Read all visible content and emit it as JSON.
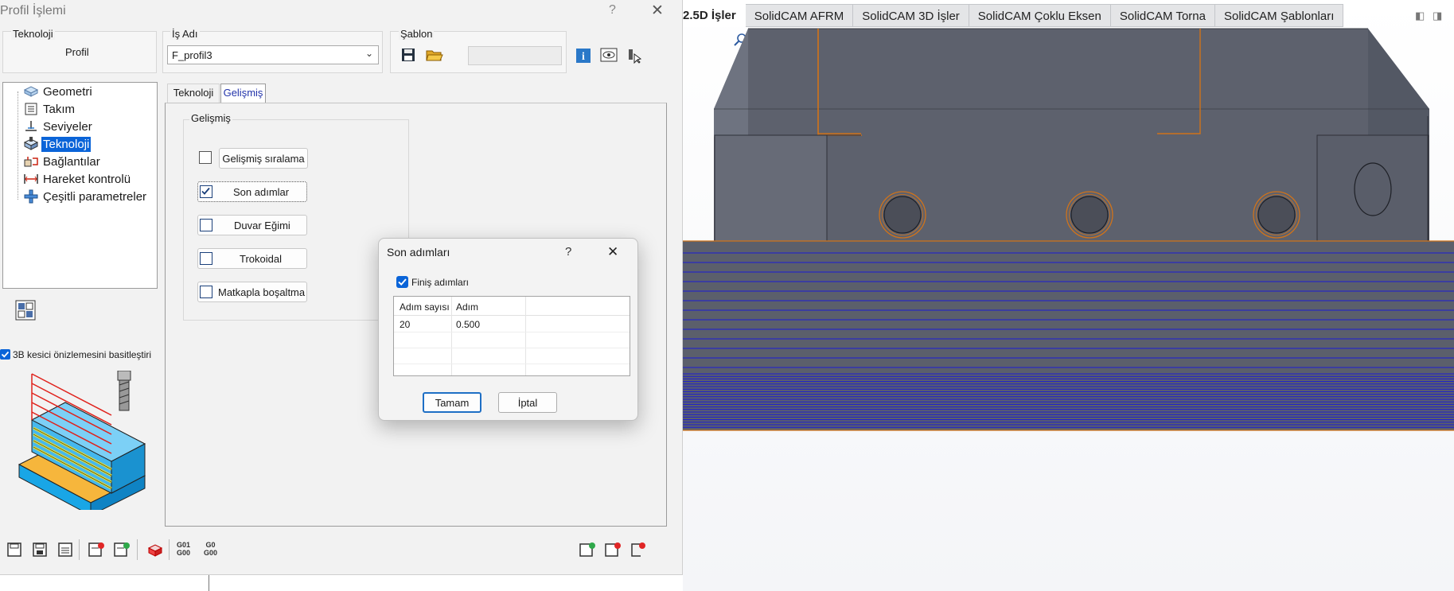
{
  "window": {
    "title": "Profil İşlemi",
    "help": "?",
    "close": "✕"
  },
  "header": {
    "teknoloji_label": "Teknoloji",
    "teknoloji_value": "Profil",
    "is_adi_label": "İş Adı",
    "is_adi_value": "F_profil3",
    "sablon_label": "Şablon"
  },
  "tree": {
    "items": [
      {
        "label": "Geometri",
        "icon": "geometry-icon"
      },
      {
        "label": "Takım",
        "icon": "tool-icon"
      },
      {
        "label": "Seviyeler",
        "icon": "levels-icon"
      },
      {
        "label": "Teknoloji",
        "icon": "technology-icon",
        "selected": true
      },
      {
        "label": "Bağlantılar",
        "icon": "links-icon"
      },
      {
        "label": "Hareket kontrolü",
        "icon": "motion-control-icon"
      },
      {
        "label": "Çeşitli parametreler",
        "icon": "misc-params-icon"
      }
    ]
  },
  "preview": {
    "checkbox_label": "3B kesici önizlemesini basitleştiri",
    "checked": true
  },
  "tabs": {
    "tab1": "Teknoloji",
    "tab2": "Gelişmiş",
    "active": "Gelişmiş"
  },
  "gelismis": {
    "group_label": "Gelişmiş",
    "options": [
      {
        "label": "Gelişmiş sıralama",
        "checked": false
      },
      {
        "label": "Son adımlar",
        "checked": true
      },
      {
        "label": "Duvar Eğimi",
        "checked": false
      },
      {
        "label": "Trokoidal",
        "checked": false
      },
      {
        "label": "Matkapla boşaltma",
        "checked": false
      }
    ]
  },
  "bottom_toolbar": {
    "g_code_1": [
      "G01",
      "G00"
    ],
    "g_code_2": [
      "G0",
      "G00"
    ]
  },
  "popup": {
    "title": "Son adımları",
    "help": "?",
    "close": "✕",
    "finish_label": "Finiş adımları",
    "finish_checked": true,
    "columns": [
      "Adım sayısı",
      "Adım"
    ],
    "rows": [
      [
        "20",
        "0.500"
      ]
    ],
    "ok": "Tamam",
    "cancel": "İptal"
  },
  "cad": {
    "tabs": [
      "2.5D İşler",
      "SolidCAM AFRM",
      "SolidCAM 3D İşler",
      "SolidCAM Çoklu Eksen",
      "SolidCAM Torna",
      "SolidCAM Şablonları"
    ],
    "colors": {
      "part": "#5d616d",
      "toolpath": "#1b1bd6",
      "contour": "#d0731a"
    }
  }
}
